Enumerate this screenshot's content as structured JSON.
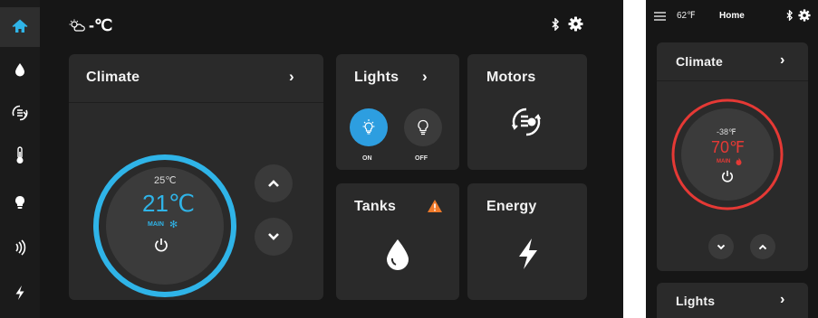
{
  "tablet": {
    "rail": {
      "items": [
        {
          "icon": "home-icon",
          "active": true
        },
        {
          "icon": "water-drop-icon",
          "active": false
        },
        {
          "icon": "climate-fan-icon",
          "active": false
        },
        {
          "icon": "thermometer-icon",
          "active": false
        },
        {
          "icon": "bulb-icon",
          "active": false
        },
        {
          "icon": "signal-waves-icon",
          "active": false
        },
        {
          "icon": "lightning-icon",
          "active": false
        }
      ]
    },
    "topbar": {
      "weather_icon": "partly-cloudy-icon",
      "temp_text": "-℃",
      "right_icons": [
        "bluetooth-icon",
        "gear-icon"
      ]
    },
    "climate": {
      "title": "Climate",
      "set_temp": "25℃",
      "current_temp": "21℃",
      "mode_label": "MAIN",
      "mode_icon": "snowflake-icon",
      "ring_color": "#2fb4e8",
      "temp_color": "#2fb4e8"
    },
    "lights": {
      "title": "Lights",
      "on_label": "ON",
      "off_label": "OFF",
      "on_color": "#2d9ee0"
    },
    "motors": {
      "title": "Motors"
    },
    "tanks": {
      "title": "Tanks",
      "warning_color": "#f07a2a"
    },
    "energy": {
      "title": "Energy"
    }
  },
  "phone": {
    "topbar": {
      "temp": "62℉",
      "title": "Home"
    },
    "climate": {
      "title": "Climate",
      "set_temp": "-38℉",
      "current_temp": "70℉",
      "mode_label": "MAIN",
      "ring_color": "#e53935",
      "temp_color": "#e53935"
    },
    "lights": {
      "title": "Lights"
    }
  }
}
